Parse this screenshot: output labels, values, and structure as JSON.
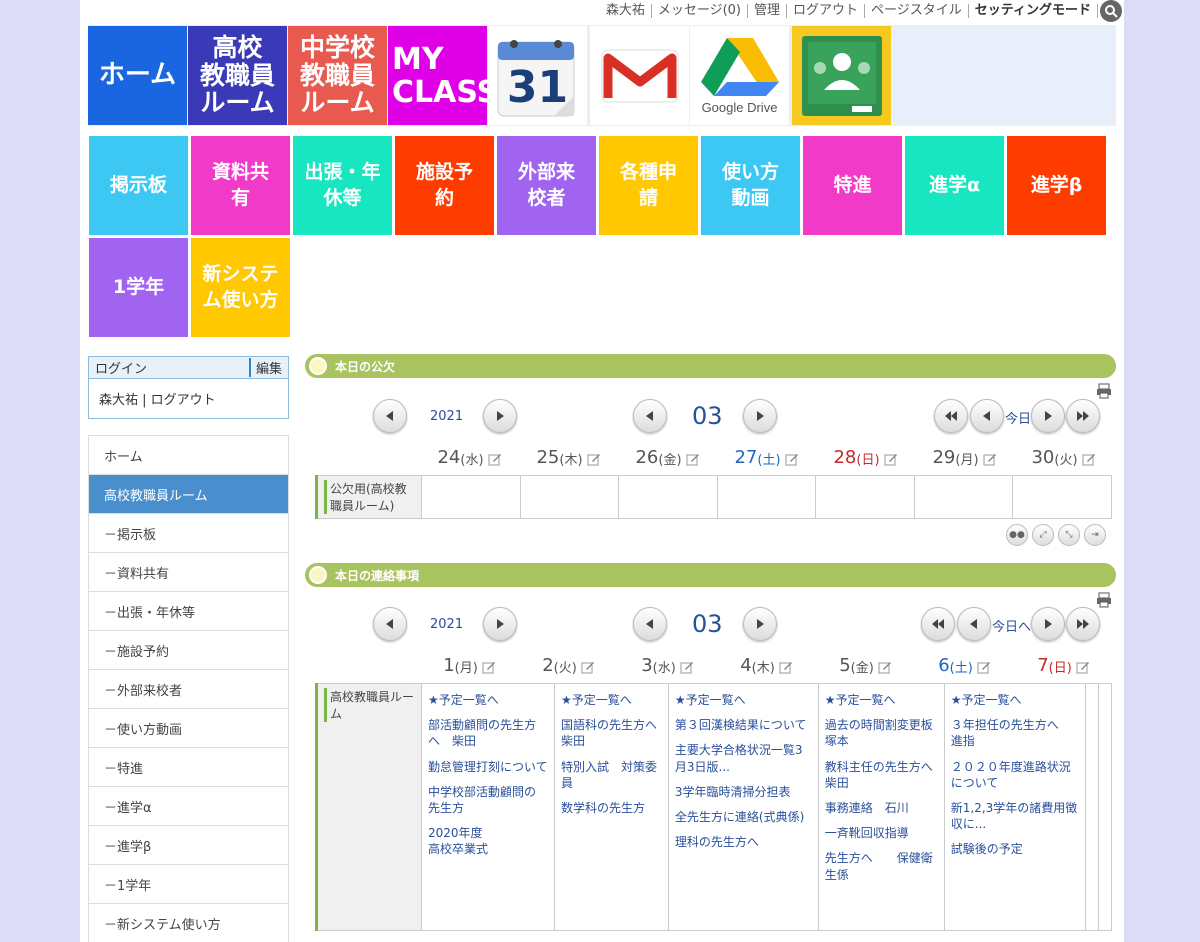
{
  "toplinks": {
    "user": "森大祐",
    "messages": "メッセージ(0)",
    "admin": "管理",
    "logout": "ログアウト",
    "page_style": "ページスタイル",
    "setting_mode": "セッティングモード"
  },
  "header_tiles": [
    {
      "label": "ホーム",
      "color": "#1a66e0"
    },
    {
      "label": "高校\n教職員\nルーム",
      "color": "#3a3ab8"
    },
    {
      "label": "中学校\n教職員\nルーム",
      "color": "#e85a4f"
    },
    {
      "label": "MY\nCLASS",
      "color": "#e000e8"
    }
  ],
  "header_icons": {
    "calendar_day": "31",
    "gmail": "M",
    "drive_label": "Google Drive"
  },
  "tiles": [
    {
      "label": "掲示板",
      "color": "#3cc8f2"
    },
    {
      "label": "資料共\n有",
      "color": "#f23ac8"
    },
    {
      "label": "出張・年\n休等",
      "color": "#18e6c0"
    },
    {
      "label": "施設予\n約",
      "color": "#ff3c00"
    },
    {
      "label": "外部来\n校者",
      "color": "#a064f0"
    },
    {
      "label": "各種申\n請",
      "color": "#ffc800"
    },
    {
      "label": "使い方\n動画",
      "color": "#3cc8f2"
    },
    {
      "label": "特進",
      "color": "#f23ac8"
    },
    {
      "label": "進学α",
      "color": "#18e6c0"
    },
    {
      "label": "進学β",
      "color": "#ff3c00"
    },
    {
      "label": "1学年",
      "color": "#a064f0"
    },
    {
      "label": "新システ\nム使い方",
      "color": "#ffc800"
    }
  ],
  "login_box": {
    "title": "ログイン",
    "edit": "編集",
    "user": "森大祐",
    "sep": " | ",
    "logout": "ログアウト"
  },
  "side_menu": [
    {
      "label": "ホーム",
      "active": false
    },
    {
      "label": "高校教職員ルーム",
      "active": true
    },
    {
      "label": "－掲示板",
      "active": false
    },
    {
      "label": "－資料共有",
      "active": false
    },
    {
      "label": "－出張・年休等",
      "active": false
    },
    {
      "label": "－施設予約",
      "active": false
    },
    {
      "label": "－外部来校者",
      "active": false
    },
    {
      "label": "－使い方動画",
      "active": false
    },
    {
      "label": "－特進",
      "active": false
    },
    {
      "label": "－進学α",
      "active": false
    },
    {
      "label": "－進学β",
      "active": false
    },
    {
      "label": "－1学年",
      "active": false
    },
    {
      "label": "－新システム使い方",
      "active": false
    }
  ],
  "section1": {
    "title": "本日の公欠",
    "year": "2021",
    "month": "03",
    "today": "今日",
    "days": [
      {
        "num": "24",
        "dow": "(水)",
        "type": "weekday"
      },
      {
        "num": "25",
        "dow": "(木)",
        "type": "weekday"
      },
      {
        "num": "26",
        "dow": "(金)",
        "type": "weekday"
      },
      {
        "num": "27",
        "dow": "(土)",
        "type": "sat"
      },
      {
        "num": "28",
        "dow": "(日)",
        "type": "sun"
      },
      {
        "num": "29",
        "dow": "(月)",
        "type": "weekday"
      },
      {
        "num": "30",
        "dow": "(火)",
        "type": "weekday"
      }
    ],
    "row_label": "公欠用(高校教職員ルーム)"
  },
  "section2": {
    "title": "本日の連絡事項",
    "year": "2021",
    "month": "03",
    "today": "今日へ",
    "days": [
      {
        "num": "1",
        "dow": "(月)",
        "type": "weekday"
      },
      {
        "num": "2",
        "dow": "(火)",
        "type": "weekday"
      },
      {
        "num": "3",
        "dow": "(水)",
        "type": "weekday"
      },
      {
        "num": "4",
        "dow": "(木)",
        "type": "weekday"
      },
      {
        "num": "5",
        "dow": "(金)",
        "type": "weekday"
      },
      {
        "num": "6",
        "dow": "(土)",
        "type": "sat"
      },
      {
        "num": "7",
        "dow": "(日)",
        "type": "sun"
      }
    ],
    "row_label": "高校教職員ルーム",
    "cells": [
      [
        "★予定一覧へ",
        "部活動顧問の先生方へ　柴田",
        "勤怠管理打刻について",
        "中学校部活動顧問の先生方",
        "2020年度\n高校卒業式"
      ],
      [
        "★予定一覧へ",
        "国語科の先生方へ　柴田",
        "特別入試　対策委員",
        "数学科の先生方"
      ],
      [
        "★予定一覧へ",
        "第３回漢検結果について",
        "主要大学合格状況一覧3月3日版...",
        "3学年臨時清掃分担表",
        "全先生方に連絡(式典係)",
        "理科の先生方へ"
      ],
      [
        "★予定一覧へ",
        "過去の時間割変更板　塚本",
        "教科主任の先生方へ　柴田",
        "事務連絡　石川",
        "一斉靴回収指導",
        "先生方へ　　保健衛生係"
      ],
      [
        "★予定一覧へ",
        "３年担任の先生方へ　進指",
        "２０２０年度進路状況について",
        "新1,2,3学年の諸費用徴収に...",
        "試験後の予定"
      ],
      [],
      []
    ]
  }
}
